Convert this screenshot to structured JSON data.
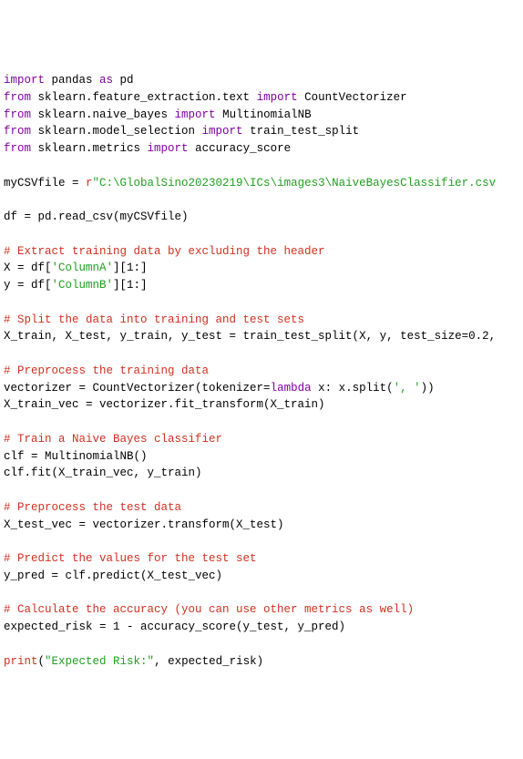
{
  "lines": [
    {
      "segments": [
        {
          "cls": "kw-import",
          "text": "import"
        },
        {
          "cls": "plain",
          "text": " pandas "
        },
        {
          "cls": "kw-import",
          "text": "as"
        },
        {
          "cls": "plain",
          "text": " pd"
        }
      ]
    },
    {
      "segments": [
        {
          "cls": "kw-from",
          "text": "from"
        },
        {
          "cls": "plain",
          "text": " sklearn.feature_extraction.text "
        },
        {
          "cls": "kw-import",
          "text": "import"
        },
        {
          "cls": "plain",
          "text": " CountVectorizer"
        }
      ]
    },
    {
      "segments": [
        {
          "cls": "kw-from",
          "text": "from"
        },
        {
          "cls": "plain",
          "text": " sklearn.naive_bayes "
        },
        {
          "cls": "kw-import",
          "text": "import"
        },
        {
          "cls": "plain",
          "text": " MultinomialNB"
        }
      ]
    },
    {
      "segments": [
        {
          "cls": "kw-from",
          "text": "from"
        },
        {
          "cls": "plain",
          "text": " sklearn.model_selection "
        },
        {
          "cls": "kw-import",
          "text": "import"
        },
        {
          "cls": "plain",
          "text": " train_test_split"
        }
      ]
    },
    {
      "segments": [
        {
          "cls": "kw-from",
          "text": "from"
        },
        {
          "cls": "plain",
          "text": " sklearn.metrics "
        },
        {
          "cls": "kw-import",
          "text": "import"
        },
        {
          "cls": "plain",
          "text": " accuracy_score"
        }
      ]
    },
    {
      "segments": [
        {
          "cls": "plain",
          "text": " "
        }
      ]
    },
    {
      "segments": [
        {
          "cls": "plain",
          "text": "myCSVfile = "
        },
        {
          "cls": "string-raw-prefix",
          "text": "r"
        },
        {
          "cls": "string",
          "text": "\"C:\\GlobalSino20230219\\ICs\\images3\\NaiveBayesClassifier.csv"
        }
      ]
    },
    {
      "segments": [
        {
          "cls": "plain",
          "text": " "
        }
      ]
    },
    {
      "segments": [
        {
          "cls": "plain",
          "text": "df = pd.read_csv(myCSVfile)"
        }
      ]
    },
    {
      "segments": [
        {
          "cls": "plain",
          "text": " "
        }
      ]
    },
    {
      "segments": [
        {
          "cls": "comment",
          "text": "# Extract training data by excluding the header"
        }
      ]
    },
    {
      "segments": [
        {
          "cls": "plain",
          "text": "X = df["
        },
        {
          "cls": "string",
          "text": "'ColumnA'"
        },
        {
          "cls": "plain",
          "text": "][1:]"
        }
      ]
    },
    {
      "segments": [
        {
          "cls": "plain",
          "text": "y = df["
        },
        {
          "cls": "string",
          "text": "'ColumnB'"
        },
        {
          "cls": "plain",
          "text": "][1:]"
        }
      ]
    },
    {
      "segments": [
        {
          "cls": "plain",
          "text": " "
        }
      ]
    },
    {
      "segments": [
        {
          "cls": "comment",
          "text": "# Split the data into training and test sets"
        }
      ]
    },
    {
      "segments": [
        {
          "cls": "plain",
          "text": "X_train, X_test, y_train, y_test = train_test_split(X, y, test_size=0.2,"
        }
      ]
    },
    {
      "segments": [
        {
          "cls": "plain",
          "text": " "
        }
      ]
    },
    {
      "segments": [
        {
          "cls": "comment",
          "text": "# Preprocess the training data"
        }
      ]
    },
    {
      "segments": [
        {
          "cls": "plain",
          "text": "vectorizer = CountVectorizer(tokenizer="
        },
        {
          "cls": "kw-lambda",
          "text": "lambda"
        },
        {
          "cls": "plain",
          "text": " x: x.split("
        },
        {
          "cls": "string",
          "text": "', '"
        },
        {
          "cls": "plain",
          "text": "))"
        }
      ]
    },
    {
      "segments": [
        {
          "cls": "plain",
          "text": "X_train_vec = vectorizer.fit_transform(X_train)"
        }
      ]
    },
    {
      "segments": [
        {
          "cls": "plain",
          "text": " "
        }
      ]
    },
    {
      "segments": [
        {
          "cls": "comment",
          "text": "# Train a Naive Bayes classifier"
        }
      ]
    },
    {
      "segments": [
        {
          "cls": "plain",
          "text": "clf = MultinomialNB()"
        }
      ]
    },
    {
      "segments": [
        {
          "cls": "plain",
          "text": "clf.fit(X_train_vec, y_train)"
        }
      ]
    },
    {
      "segments": [
        {
          "cls": "plain",
          "text": " "
        }
      ]
    },
    {
      "segments": [
        {
          "cls": "comment",
          "text": "# Preprocess the test data"
        }
      ]
    },
    {
      "segments": [
        {
          "cls": "plain",
          "text": "X_test_vec = vectorizer.transform(X_test)"
        }
      ]
    },
    {
      "segments": [
        {
          "cls": "plain",
          "text": " "
        }
      ]
    },
    {
      "segments": [
        {
          "cls": "comment",
          "text": "# Predict the values for the test set"
        }
      ]
    },
    {
      "segments": [
        {
          "cls": "plain",
          "text": "y_pred = clf.predict(X_test_vec)"
        }
      ]
    },
    {
      "segments": [
        {
          "cls": "plain",
          "text": " "
        }
      ]
    },
    {
      "segments": [
        {
          "cls": "comment",
          "text": "# Calculate the accuracy (you can use other metrics as well)"
        }
      ]
    },
    {
      "segments": [
        {
          "cls": "plain",
          "text": "expected_risk = 1 - accuracy_score(y_test, y_pred)"
        }
      ]
    },
    {
      "segments": [
        {
          "cls": "plain",
          "text": " "
        }
      ]
    },
    {
      "segments": [
        {
          "cls": "builtin",
          "text": "print"
        },
        {
          "cls": "plain",
          "text": "("
        },
        {
          "cls": "string",
          "text": "\"Expected Risk:\""
        },
        {
          "cls": "plain",
          "text": ", expected_risk)"
        }
      ]
    }
  ]
}
